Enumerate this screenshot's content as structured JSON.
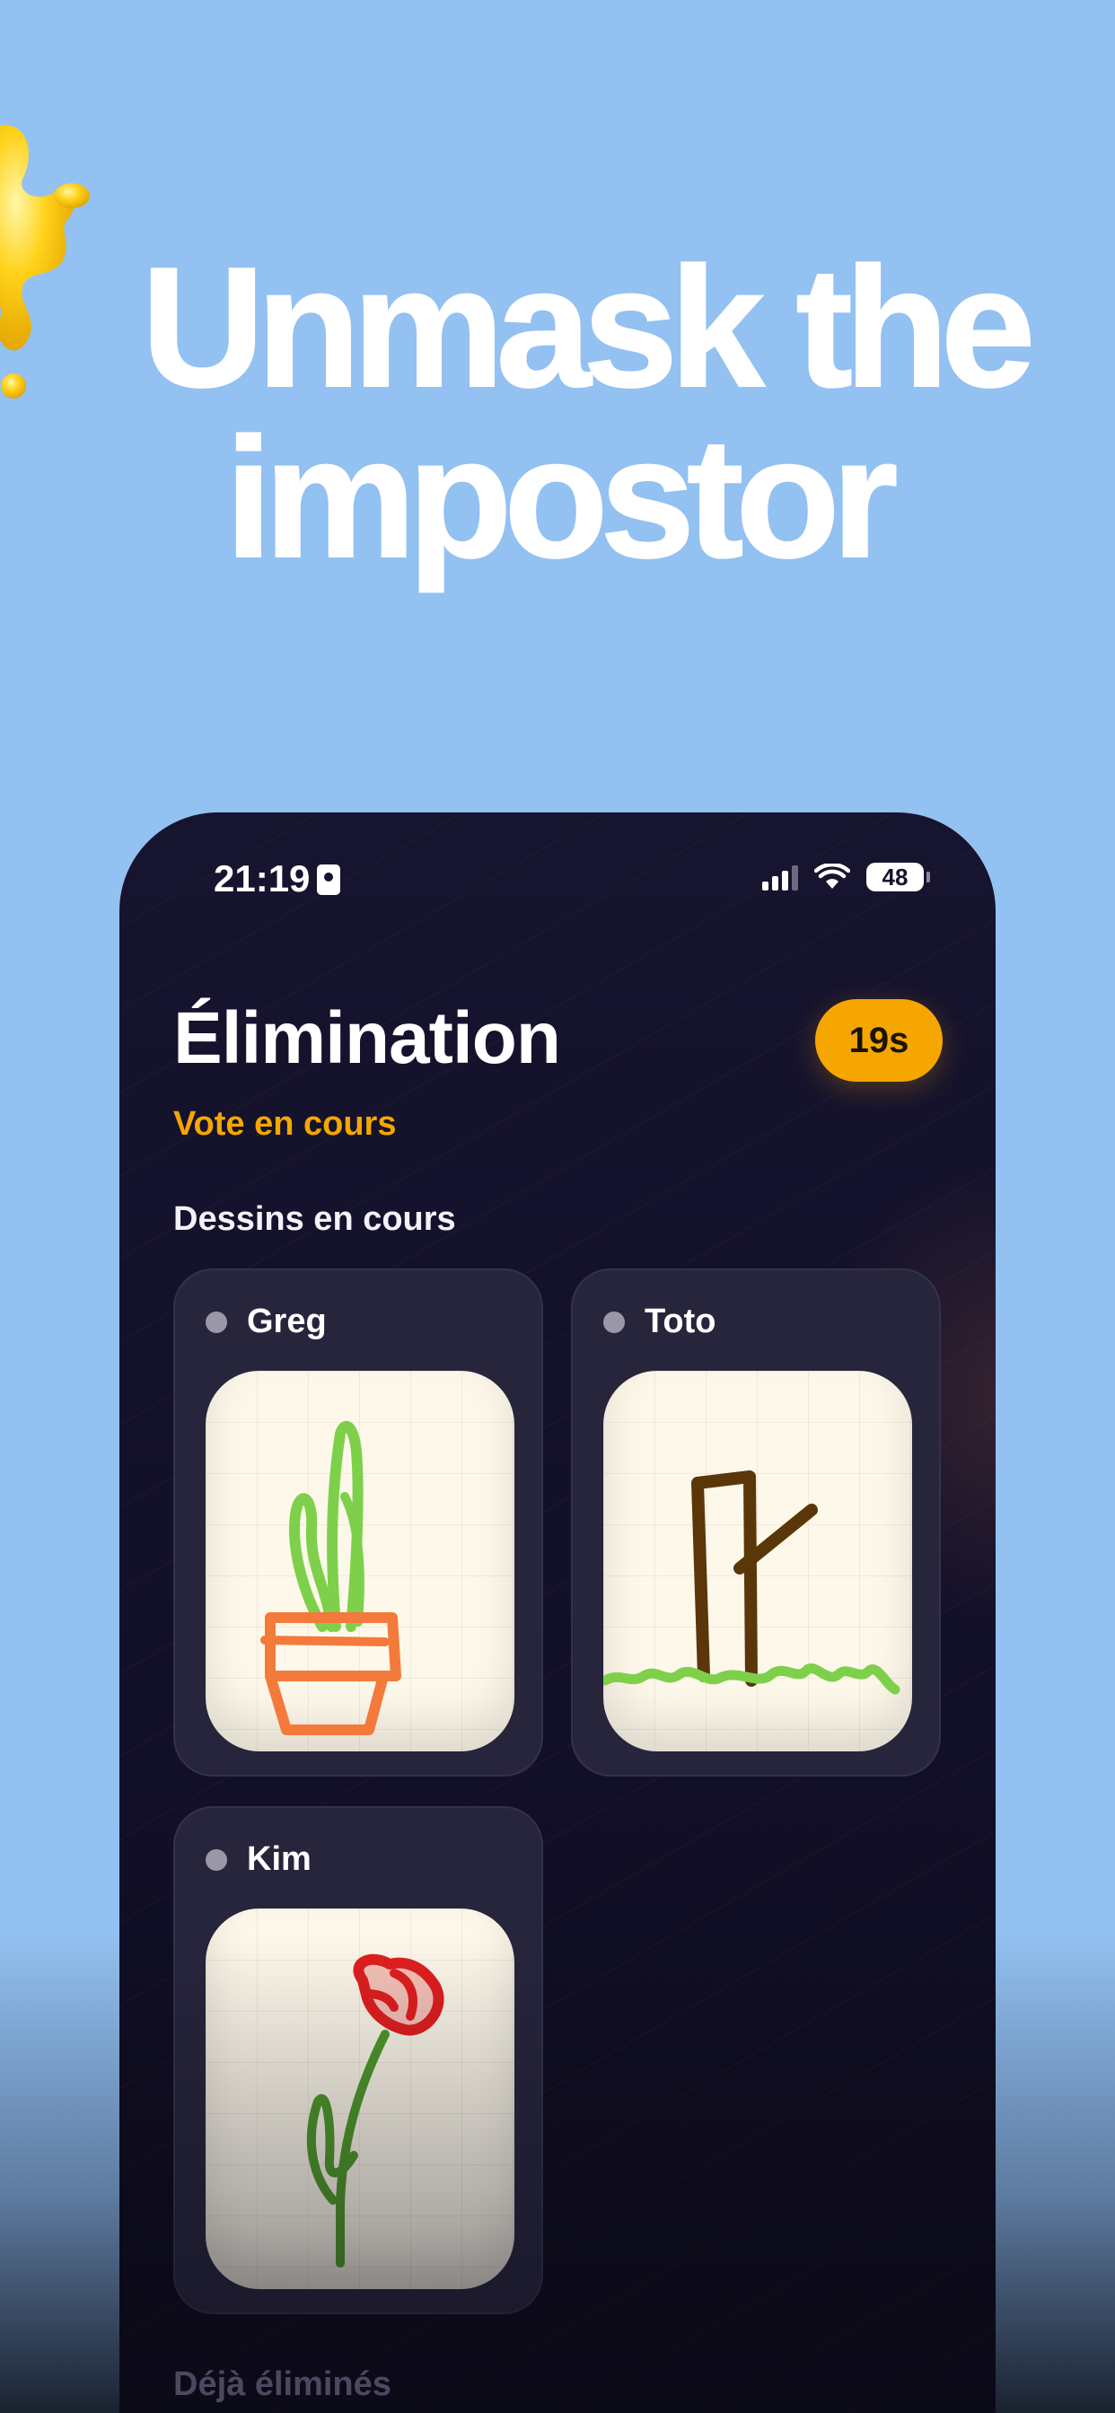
{
  "promo": {
    "headline_line1": "Unmask the",
    "headline_line2": "impostor"
  },
  "status_bar": {
    "time": "21:19",
    "battery": "48"
  },
  "screen": {
    "title": "Élimination",
    "timer": "19s",
    "subtitle": "Vote en cours",
    "section_title": "Dessins en cours",
    "players": [
      {
        "name": "Greg",
        "drawing": "plant-pot-drawing"
      },
      {
        "name": "Toto",
        "drawing": "tree-grass-drawing"
      },
      {
        "name": "Kim",
        "drawing": "red-flower-drawing"
      }
    ],
    "eliminated_title": "Déjà éliminés"
  },
  "colors": {
    "background": "#93c1f1",
    "phone": "#16142e",
    "accent": "#f6a600",
    "card": "#27253c",
    "canvas": "#fdf8ea"
  }
}
